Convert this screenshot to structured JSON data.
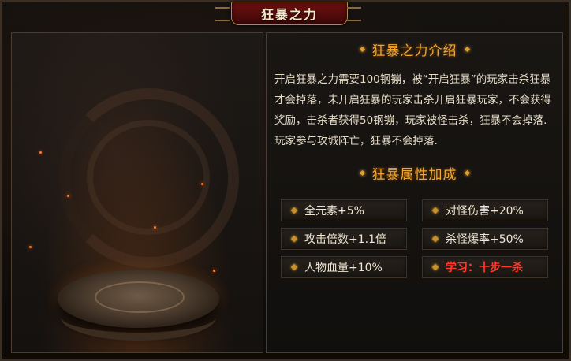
{
  "window": {
    "title": "狂暴之力"
  },
  "intro": {
    "heading": "狂暴之力介绍",
    "text": "开启狂暴之力需要100钢镚，被“开启狂暴”的玩家击杀狂暴才会掉落，未开启狂暴的玩家击杀开启狂暴玩家，不会获得奖励，击杀者获得50钢镚，玩家被怪击杀，狂暴不会掉落.玩家参与攻城阵亡，狂暴不会掉落."
  },
  "bonus": {
    "heading": "狂暴属性加成",
    "stats": [
      {
        "label": "全元素+5%"
      },
      {
        "label": "对怪伤害+20%"
      },
      {
        "label": "攻击倍数+1.1倍"
      },
      {
        "label": "杀怪爆率+50%"
      },
      {
        "label": "人物血量+10%"
      },
      {
        "label": "学习：十步一杀"
      }
    ]
  },
  "colors": {
    "accent": "#f3a52c",
    "learn_red": "#ff3a2a",
    "title_bg": "#6e1010"
  }
}
